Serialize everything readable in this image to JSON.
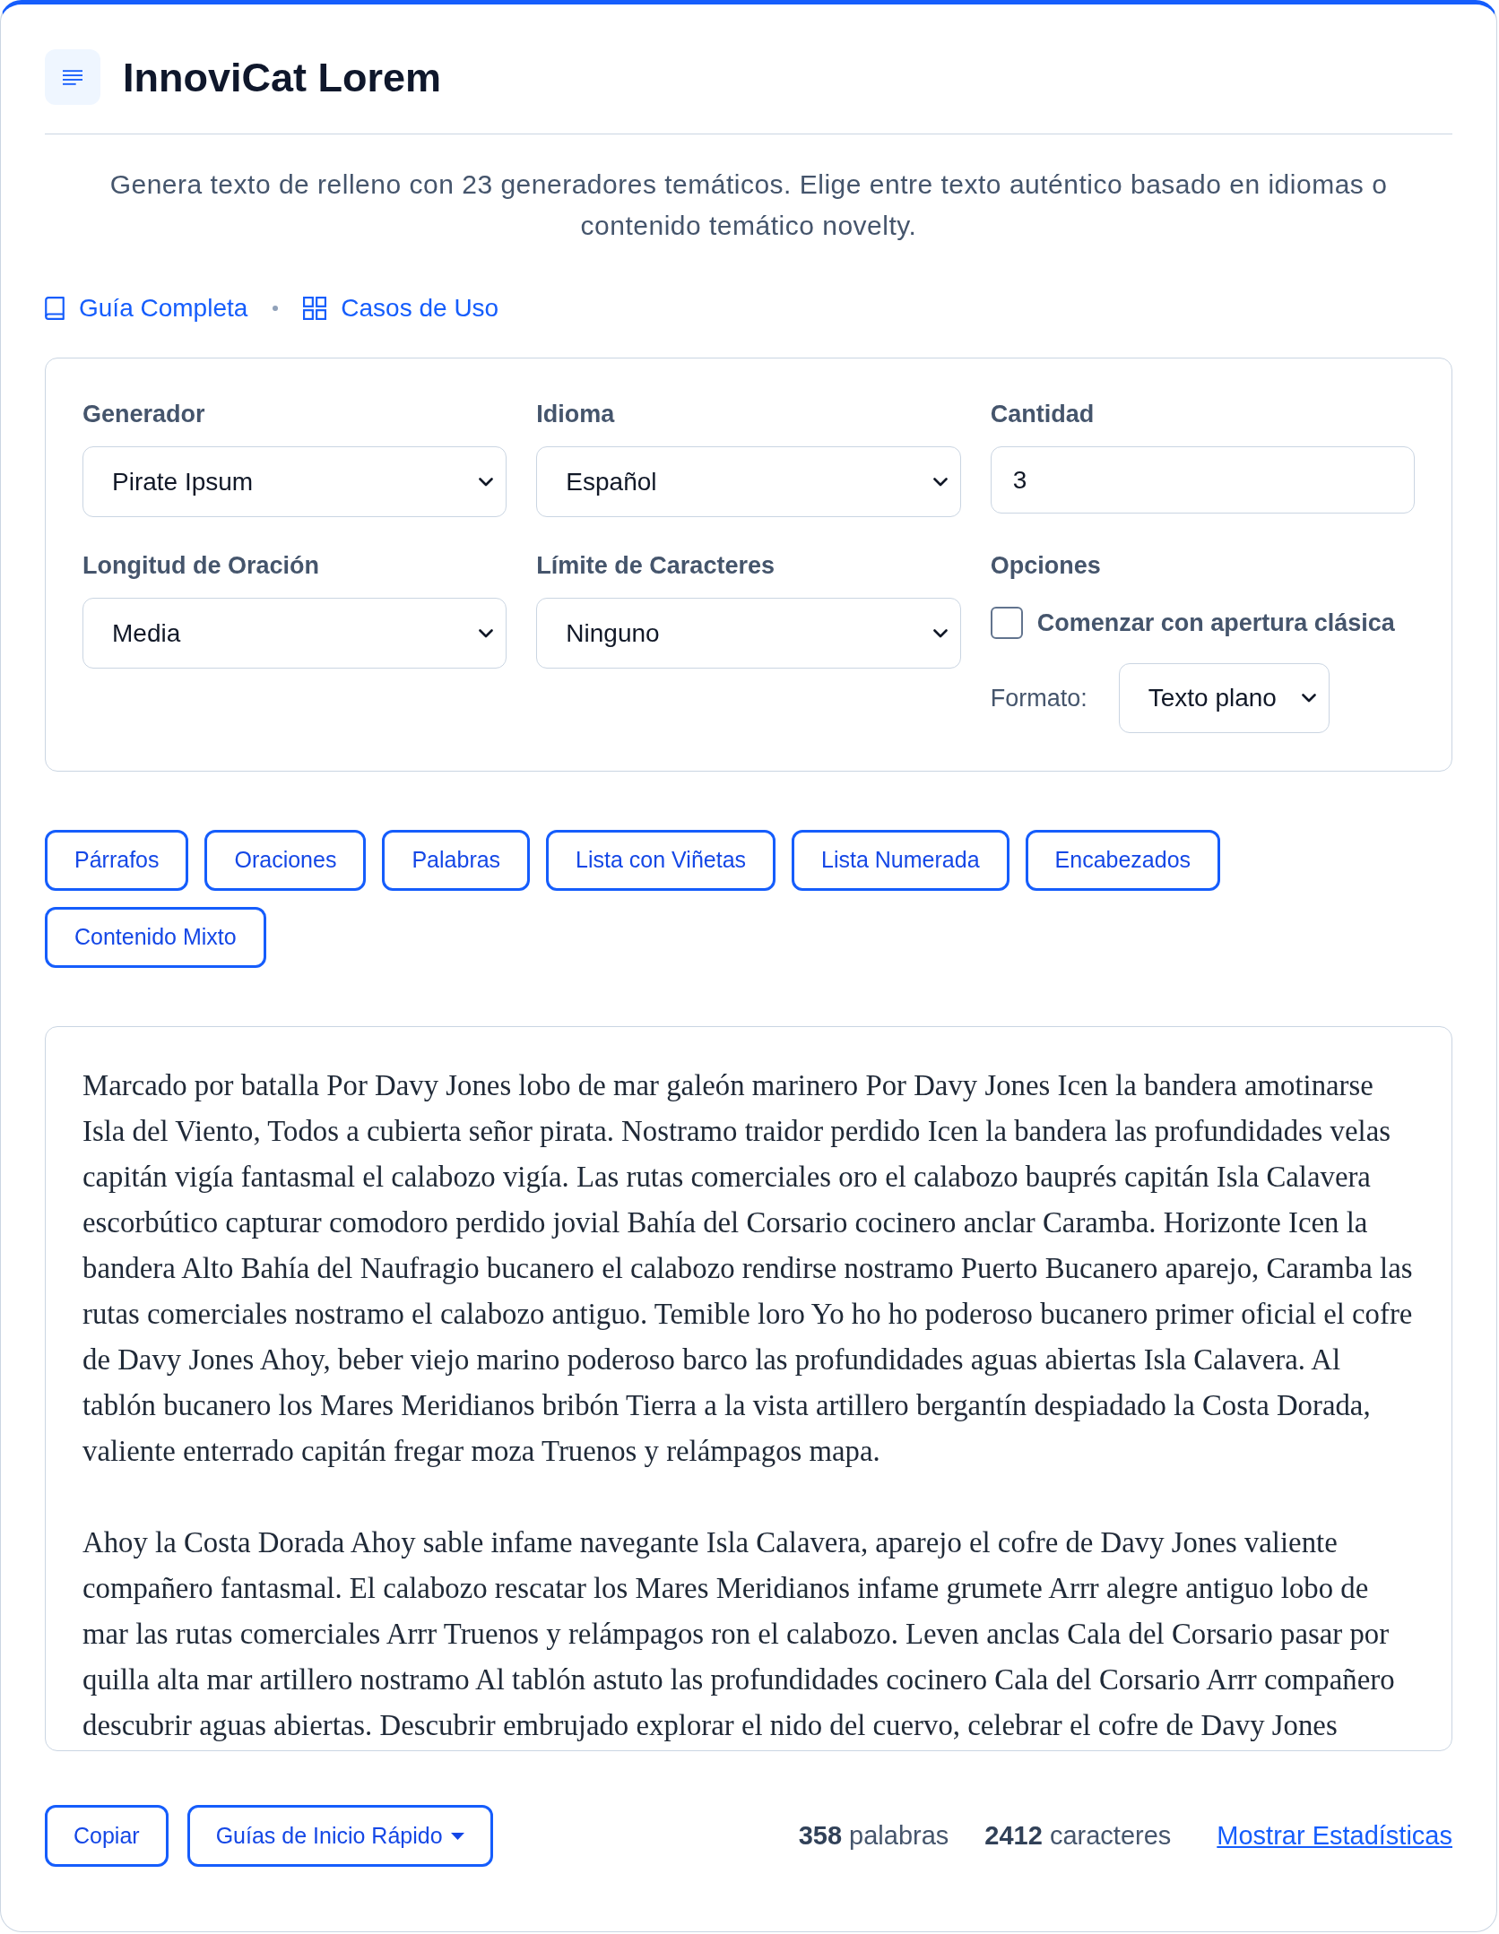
{
  "header": {
    "title": "InnoviCat Lorem",
    "description": "Genera texto de relleno con 23 generadores temáticos. Elige entre texto auténtico basado en idiomas o contenido temático novelty."
  },
  "links": [
    {
      "kind": "book",
      "label": "Guía Completa"
    },
    {
      "kind": "grid",
      "label": "Casos de Uso"
    }
  ],
  "settings": {
    "fields": [
      {
        "kind": "select",
        "label": "Generador",
        "value": "Pirate Ipsum"
      },
      {
        "kind": "select",
        "label": "Idioma",
        "value": "Español"
      },
      {
        "kind": "input",
        "label": "Cantidad",
        "value": "3"
      },
      {
        "kind": "select",
        "label": "Longitud de Oración",
        "value": "Media"
      },
      {
        "kind": "select",
        "label": "Límite de Caracteres",
        "value": "Ninguno"
      },
      {
        "kind": "options",
        "label": "Opciones",
        "checkbox": {
          "label": "Comenzar con apertura clásica",
          "checked": false
        },
        "format": {
          "label": "Formato:",
          "value": "Texto plano"
        }
      }
    ]
  },
  "type_buttons": [
    "Párrafos",
    "Oraciones",
    "Palabras",
    "Lista con Viñetas",
    "Lista Numerada",
    "Encabezados",
    "Contenido Mixto"
  ],
  "output": {
    "paragraphs": [
      "Marcado por batalla Por Davy Jones lobo de mar galeón marinero Por Davy Jones Icen la bandera amotinarse Isla del Viento, Todos a cubierta señor pirata. Nostramo traidor perdido Icen la bandera las profundidades velas capitán vigía fantasmal el calabozo vigía. Las rutas comerciales oro el calabozo bauprés capitán Isla Calavera escorbútico capturar comodoro perdido jovial Bahía del Corsario cocinero anclar Caramba. Horizonte Icen la bandera Alto Bahía del Naufragio bucanero el calabozo rendirse nostramo Puerto Bucanero aparejo, Caramba las rutas comerciales nostramo el calabozo antiguo. Temible loro Yo ho ho poderoso bucanero primer oficial el cofre de Davy Jones Ahoy, beber viejo marino poderoso barco las profundidades aguas abiertas Isla Calavera. Al tablón bucanero los Mares Meridianos bribón Tierra a la vista artillero bergantín despiadado la Costa Dorada, valiente enterrado capitán fregar moza Truenos y relámpagos mapa.",
      "Ahoy la Costa Dorada Ahoy sable infame navegante Isla Calavera, aparejo el cofre de Davy Jones valiente compañero fantasmal. El calabozo rescatar los Mares Meridianos infame grumete Arrr alegre antiguo lobo de mar las rutas comerciales Arrr Truenos y relámpagos ron el calabozo. Leven anclas Cala del Corsario pasar por quilla alta mar artillero nostramo Al tablón astuto las profundidades cocinero Cala del Corsario Arrr compañero descubrir aguas abiertas. Descubrir embrujado explorar el nido del cuervo, celebrar el cofre de Davy Jones"
    ]
  },
  "footer": {
    "buttons": [
      {
        "kind": "plain",
        "label": "Copiar"
      },
      {
        "kind": "dropdown",
        "label": "Guías de Inicio Rápido"
      }
    ],
    "stats": [
      "**358** palabras",
      "**2412** caracteres"
    ],
    "link": "Mostrar Estadísticas"
  }
}
